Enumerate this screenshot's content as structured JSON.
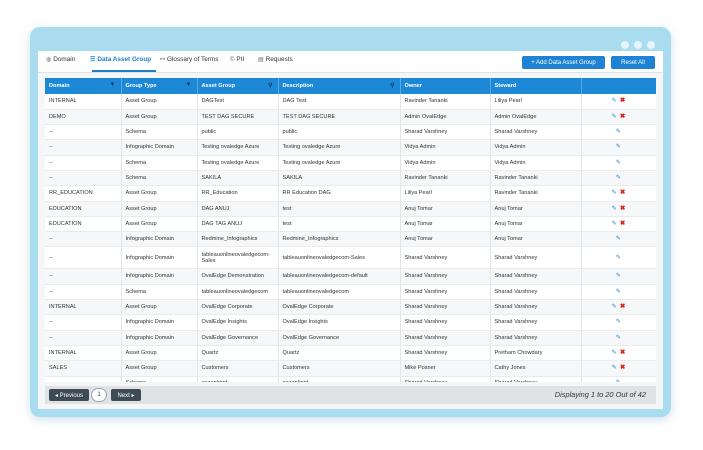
{
  "tabs": [
    {
      "icon": "globe-icon",
      "glyph": "◍",
      "label": "Domain"
    },
    {
      "icon": "database-icon",
      "glyph": "☰",
      "label": "Data Asset Group"
    },
    {
      "icon": "sitemap-icon",
      "glyph": "⚯",
      "label": "Glossary of Terms"
    },
    {
      "icon": "shield-icon",
      "glyph": "©",
      "label": "PII"
    },
    {
      "icon": "document-icon",
      "glyph": "▤",
      "label": "Requests"
    }
  ],
  "actions": {
    "add_label": "+ Add Data Asset Group",
    "reset_label": "Reset All"
  },
  "columns": [
    "Domain",
    "Group Type",
    "Asset Group",
    "Description",
    "Owner",
    "Steward",
    ""
  ],
  "rows": [
    {
      "domain": "INTERNAL",
      "type": "Asset Group",
      "group": "DAGTest",
      "desc": "DAG Test",
      "owner": "Ravinder Tananki",
      "steward": "Liliya Pearl",
      "del": true
    },
    {
      "domain": "DEMO",
      "type": "Asset Group",
      "group": "TEST DAG SECURE",
      "desc": "TEST DAG SECURE",
      "owner": "Admin OvalEdge",
      "steward": "Admin OvalEdge",
      "del": true
    },
    {
      "domain": "--",
      "type": "Schema",
      "group": "public",
      "desc": "public",
      "owner": "Sharad Varshney",
      "steward": "Sharad Varshney",
      "del": false
    },
    {
      "domain": "--",
      "type": "Infographic Domain",
      "group": "Testing ovaledge Azure",
      "desc": "Testing ovaledge Azure",
      "owner": "Vidya Admin",
      "steward": "Vidya Admin",
      "del": false
    },
    {
      "domain": "--",
      "type": "Schema",
      "group": "Testing ovaledge Azure",
      "desc": "Testing ovaledge Azure",
      "owner": "Vidya Admin",
      "steward": "Vidya Admin",
      "del": false
    },
    {
      "domain": "--",
      "type": "Schema",
      "group": "SAKILA",
      "desc": "SAKILA",
      "owner": "Ravinder Tananki",
      "steward": "Ravinder Tananki",
      "del": false
    },
    {
      "domain": "RR_EDUCATION",
      "type": "Asset Group",
      "group": "RR_Education",
      "desc": "RR Education DAG",
      "owner": "Liliya Pearl",
      "steward": "Ravinder Tananki",
      "del": true
    },
    {
      "domain": "EDUCATION",
      "type": "Asset Group",
      "group": "DAG ANUJ",
      "desc": "test",
      "owner": "Anuj Tomar",
      "steward": "Anuj Tomar",
      "del": true
    },
    {
      "domain": "EDUCATION",
      "type": "Asset Group",
      "group": "DAG TAG ANUJ",
      "desc": "test",
      "owner": "Anuj Tomar",
      "steward": "Anuj Tomar",
      "del": true
    },
    {
      "domain": "--",
      "type": "Infographic Domain",
      "group": "Redmine_Infographics",
      "desc": "Redmine_Infographics",
      "owner": "Anuj Tomar",
      "steward": "Anuj Tomar",
      "del": false
    },
    {
      "domain": "--",
      "type": "Infographic Domain",
      "group": "tableauonlineovaledgecom-Sales",
      "desc": "tableauonlineovaledgecom-Sales",
      "owner": "Sharad Varshney",
      "steward": "Sharad Varshney",
      "del": false,
      "tall": true
    },
    {
      "domain": "--",
      "type": "Infographic Domain",
      "group": "OvalEdge Demonstration",
      "desc": "tableauonlineovaledgecom-default",
      "owner": "Sharad Varshney",
      "steward": "Sharad Varshney",
      "del": false
    },
    {
      "domain": "--",
      "type": "Schema",
      "group": "tableauonlineovaledgecom",
      "desc": "tableauonlineovaledgecom",
      "owner": "Sharad Varshney",
      "steward": "Sharad Varshney",
      "del": false
    },
    {
      "domain": "INTERNAL",
      "type": "Asset Group",
      "group": "OvalEdge Corporate",
      "desc": "OvalEdge Corporate",
      "owner": "Sharad Varshney",
      "steward": "Sharad Varshney",
      "del": true
    },
    {
      "domain": "--",
      "type": "Infographic Domain",
      "group": "OvalEdge Insights",
      "desc": "OvalEdge Insights",
      "owner": "Sharad Varshney",
      "steward": "Sharad Varshney",
      "del": false
    },
    {
      "domain": "--",
      "type": "Infographic Domain",
      "group": "OvalEdge Governance",
      "desc": "OvalEdge Governance",
      "owner": "Sharad Varshney",
      "steward": "Sharad Varshney",
      "del": false
    },
    {
      "domain": "INTERNAL",
      "type": "Asset Group",
      "group": "Quartz",
      "desc": "Quartz",
      "owner": "Sharad Varshney",
      "steward": "Pretham Chowdary",
      "del": true
    },
    {
      "domain": "SALES",
      "type": "Asset Group",
      "group": "Customers",
      "desc": "Customers",
      "owner": "Mike Posner",
      "steward": "Cathy Jones",
      "del": true
    },
    {
      "domain": "--",
      "type": "Schema",
      "group": "oezeplmnt",
      "desc": "oezeplmnt",
      "owner": "Sharad Varshney",
      "steward": "Sharad Varshney",
      "del": false
    }
  ],
  "pagination": {
    "prev_label": "◂ Previous",
    "page": "1",
    "next_label": "Next ▸",
    "status": "Displaying 1 to 20 Out of 42"
  },
  "colors": {
    "header": "#1d88d6",
    "accent": "#1f82d2",
    "delete": "#d9251c",
    "frame": "#a9dcef"
  }
}
